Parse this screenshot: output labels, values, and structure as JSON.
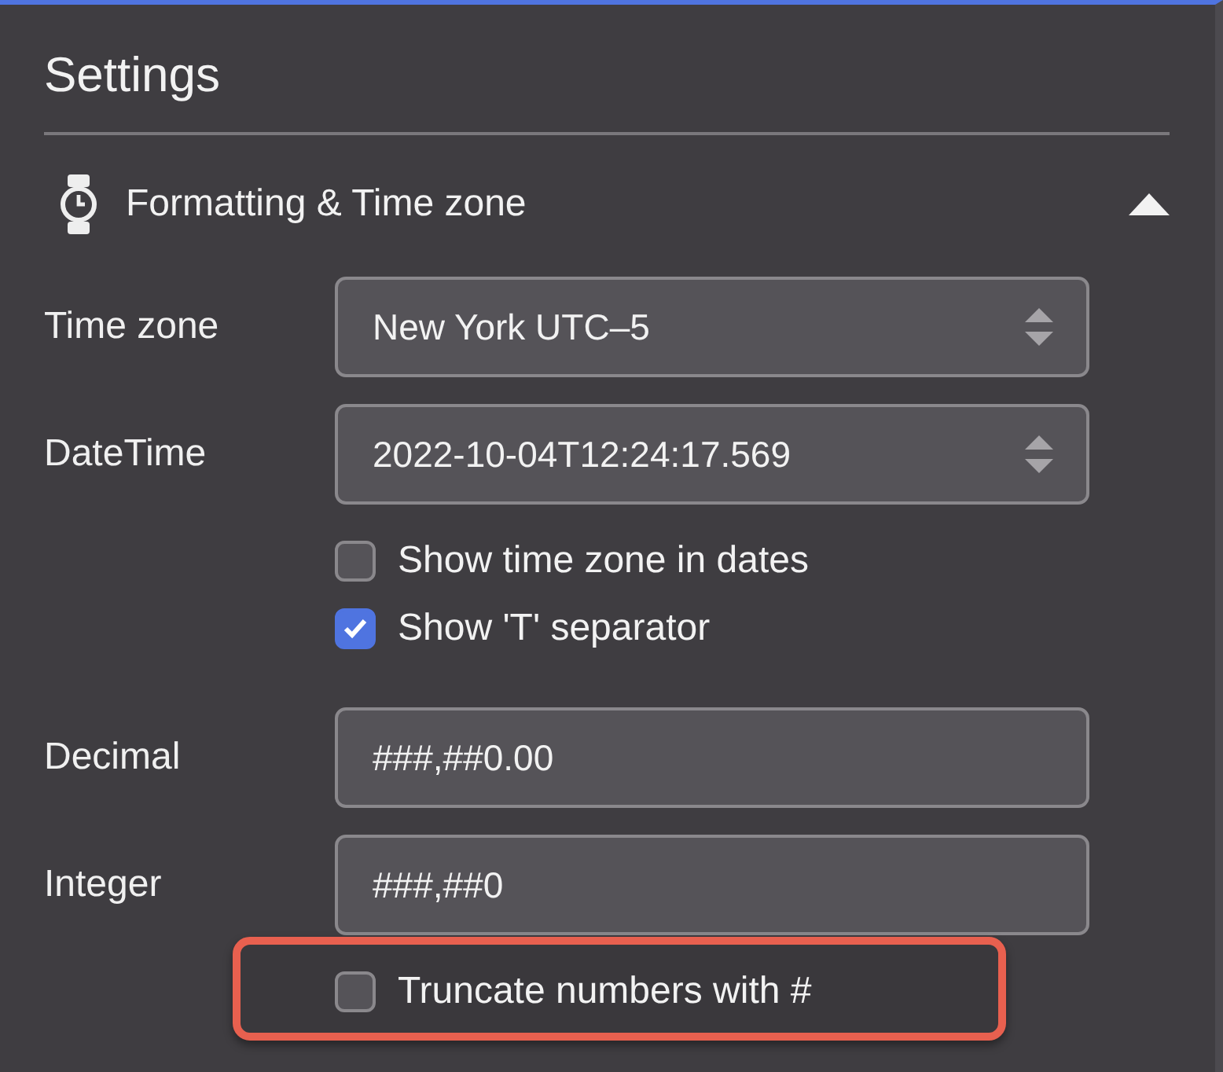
{
  "title": "Settings",
  "section": {
    "title": "Formatting & Time zone",
    "expanded": true,
    "rows": [
      {
        "kind": "select",
        "label": "Time zone",
        "value": "New York UTC–5"
      },
      {
        "kind": "select",
        "label": "DateTime",
        "value": "2022-10-04T12:24:17.569"
      },
      {
        "kind": "checkbox",
        "label": "Show time zone in dates",
        "checked": false,
        "highlighted": false
      },
      {
        "kind": "checkbox",
        "label": "Show 'T' separator",
        "checked": true,
        "highlighted": false
      },
      {
        "kind": "text",
        "label": "Decimal",
        "value": "###,##0.00"
      },
      {
        "kind": "text",
        "label": "Integer",
        "value": "###,##0"
      },
      {
        "kind": "checkbox",
        "label": "Truncate numbers with #",
        "checked": false,
        "highlighted": true
      }
    ]
  }
}
